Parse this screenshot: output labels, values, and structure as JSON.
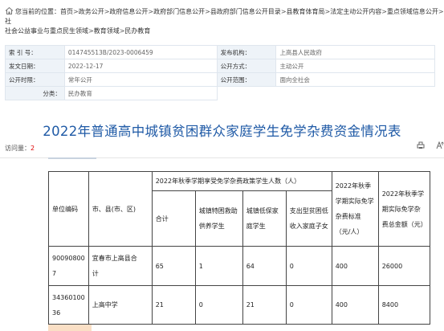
{
  "breadcrumb": {
    "prefix": "您当前的位置：",
    "items": [
      "首页",
      "政务公开",
      "政府信息公开",
      "政府部门信息公开",
      "县政府部门信息公开目录",
      "县教育体育局",
      "法定主动公开内容",
      "重点领域信息公开",
      "社会公益事业与重点民生领域",
      "教育领域",
      "民办教育"
    ],
    "truncated_suffix": "社"
  },
  "meta": {
    "index_label": "索 引 号：",
    "index_value": "014745513B/2023-0006459",
    "publisher_label": "发布机构：",
    "publisher_value": "上高县人民政府",
    "date_label": "发文日期：",
    "date_value": "2022-12-17",
    "method_label": "公开方式：",
    "method_value": "主动公开",
    "period_label": "公开时限：",
    "period_value": "常年公开",
    "scope_label": "公开范围：",
    "scope_value": "面向全社会",
    "category_label": "分类：",
    "category_value": "民办教育"
  },
  "article": {
    "title": "2022年普通高中城镇贫困群众家庭学生免学杂费资金情况表",
    "visits_label": "访问量：",
    "visits_count": "2"
  },
  "table": {
    "col_unit": "单位编码",
    "col_county": "市、县(市、区)",
    "group_header": "2022年秋季学期享受免学杂费政策学生人数（人）",
    "col_total": "合计",
    "col_poor": "城镇特困救助供养学生",
    "col_lowincome": "城镇低保家庭学生",
    "col_support": "支出型贫困低收入家庭子女",
    "col_standard": "2022年秋季学期实际免学杂费标准（元/人）",
    "col_amount": "2022年秋季学期实际免学杂费总金额（元）",
    "rows": [
      {
        "unit_a": "90090800",
        "unit_b": "7",
        "county_a": "宜春市上高县合",
        "county_b": "计",
        "total": "65",
        "poor": "1",
        "lowincome": "64",
        "support": "0",
        "standard": "400",
        "amount": "26000"
      },
      {
        "unit_a": "34360100",
        "unit_b": "36",
        "county_a": "上高中学",
        "county_b": "",
        "total": "21",
        "poor": "0",
        "lowincome": "21",
        "support": "0",
        "standard": "400",
        "amount": "8400"
      }
    ]
  }
}
